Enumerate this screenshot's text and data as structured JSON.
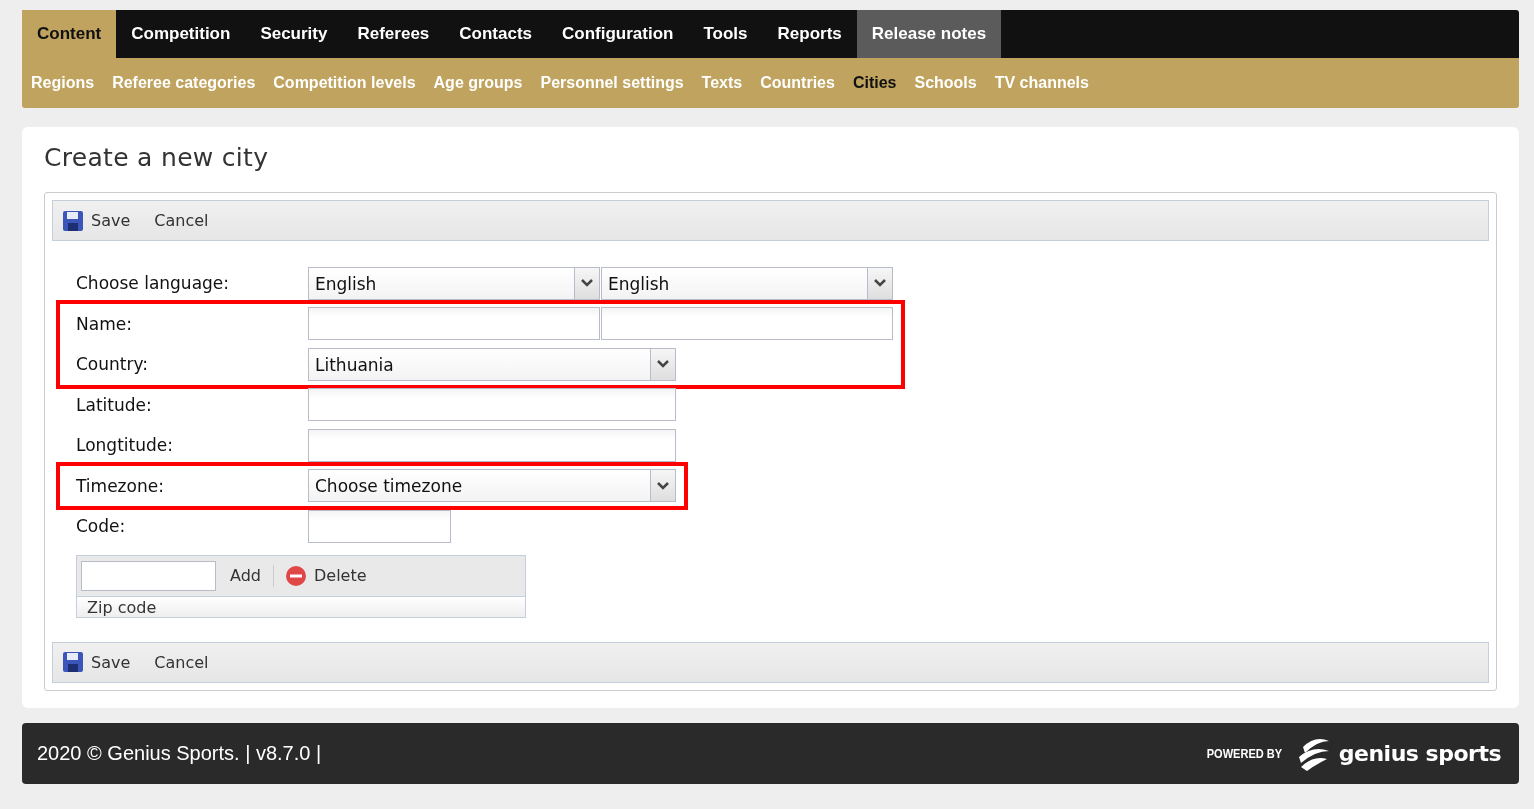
{
  "main_nav": [
    {
      "label": "Content",
      "selected": true
    },
    {
      "label": "Competition",
      "selected": false
    },
    {
      "label": "Security",
      "selected": false
    },
    {
      "label": "Referees",
      "selected": false
    },
    {
      "label": "Contacts",
      "selected": false
    },
    {
      "label": "Configuration",
      "selected": false
    },
    {
      "label": "Tools",
      "selected": false
    },
    {
      "label": "Reports",
      "selected": false
    },
    {
      "label": "Release notes",
      "selected": false,
      "highlighted": true
    }
  ],
  "sub_nav": [
    {
      "label": "Regions",
      "selected": false
    },
    {
      "label": "Referee categories",
      "selected": false
    },
    {
      "label": "Competition levels",
      "selected": false
    },
    {
      "label": "Age groups",
      "selected": false
    },
    {
      "label": "Personnel settings",
      "selected": false
    },
    {
      "label": "Texts",
      "selected": false
    },
    {
      "label": "Countries",
      "selected": false
    },
    {
      "label": "Cities",
      "selected": true
    },
    {
      "label": "Schools",
      "selected": false
    },
    {
      "label": "TV channels",
      "selected": false
    }
  ],
  "page_title": "Create a new city",
  "toolbar_top": {
    "save": "Save",
    "cancel": "Cancel"
  },
  "form_rows": [
    {
      "label": "Choose language:",
      "highlighted": false,
      "fields": [
        {
          "kind": "select",
          "value": "English"
        },
        {
          "kind": "select",
          "value": "English"
        }
      ]
    },
    {
      "label": "Name:",
      "highlighted": true,
      "fields": [
        {
          "kind": "input"
        },
        {
          "kind": "input"
        }
      ]
    },
    {
      "label": "Country:",
      "highlighted": true,
      "fields": [
        {
          "kind": "select-wide",
          "value": "Lithuania"
        }
      ]
    },
    {
      "label": "Latitude:",
      "highlighted": false,
      "fields": [
        {
          "kind": "input-wide"
        }
      ]
    },
    {
      "label": "Longtitude:",
      "highlighted": false,
      "fields": [
        {
          "kind": "input-wide"
        }
      ]
    },
    {
      "label": "Timezone:",
      "highlighted": true,
      "fields": [
        {
          "kind": "select-wide",
          "value": "Choose timezone"
        }
      ]
    },
    {
      "label": "Code:",
      "highlighted": false,
      "fields": [
        {
          "kind": "input-short"
        }
      ]
    }
  ],
  "zip_grid": {
    "add": "Add",
    "delete": "Delete",
    "column": "Zip code"
  },
  "toolbar_bottom": {
    "save": "Save",
    "cancel": "Cancel"
  },
  "footer": {
    "copyright": "2020 © Genius Sports. | v8.7.0 |",
    "powered_by": "POWERED BY",
    "brand": "genius sports"
  }
}
